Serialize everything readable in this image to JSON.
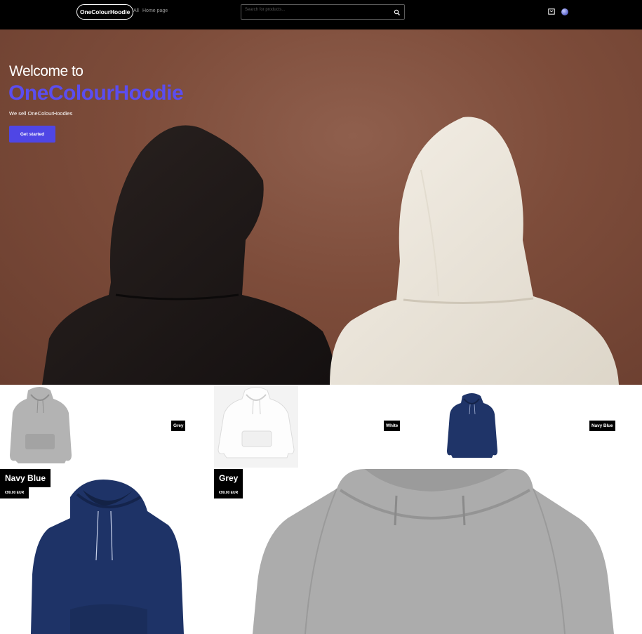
{
  "header": {
    "logo": "OneColourHoodie",
    "nav": [
      "All",
      "Home page"
    ],
    "search_placeholder": "Search for products..."
  },
  "hero": {
    "title_line1": "Welcome to",
    "title_line2": "OneColourHoodie",
    "subtitle": "We sell OneColourHoodies",
    "cta": "Get started"
  },
  "products": [
    {
      "name": "Grey"
    },
    {
      "name": "White"
    },
    {
      "name": "Navy Blue"
    }
  ],
  "featured": [
    {
      "name": "Navy Blue",
      "price": "€99.00 EUR"
    },
    {
      "name": "Grey",
      "price": "€99.00 EUR"
    }
  ],
  "colors": {
    "accent": "#4f46e5",
    "navy": "#1f3468",
    "grey": "#a9a9a9"
  }
}
